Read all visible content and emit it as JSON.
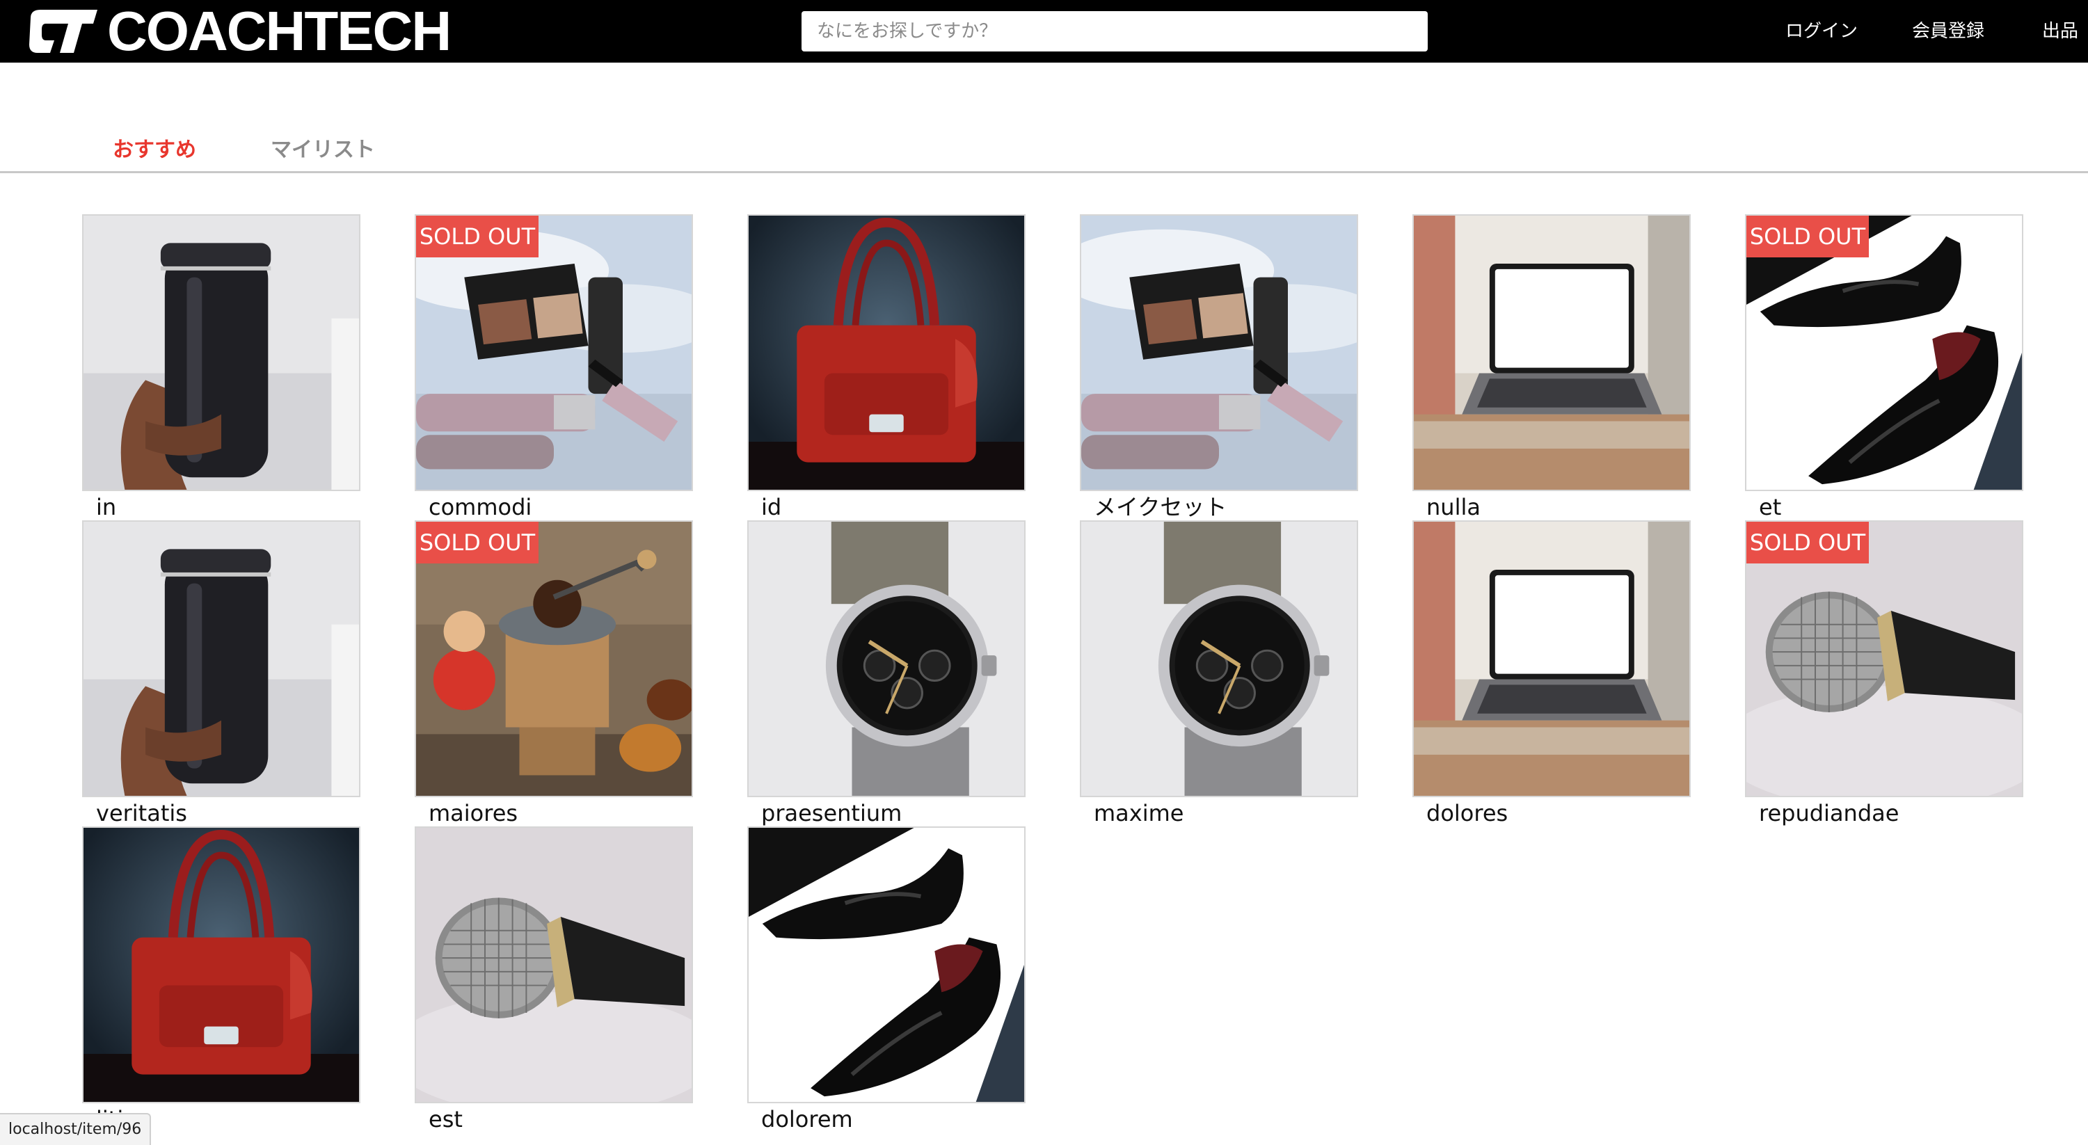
{
  "header": {
    "logo_text": "COACHTECH",
    "search_placeholder": "なにをお探しですか？",
    "nav": {
      "login": "ログイン",
      "register": "会員登録",
      "sell": "出品"
    }
  },
  "tabs": {
    "recommend": "おすすめ",
    "mylist": "マイリスト"
  },
  "sold_label": "SOLD OUT",
  "items": [
    {
      "name": "in",
      "image": "tumbler",
      "sold": false
    },
    {
      "name": "commodi",
      "image": "makeup-set",
      "sold": true
    },
    {
      "name": "id",
      "image": "red-handbag",
      "sold": false
    },
    {
      "name": "メイクセット",
      "image": "makeup-set",
      "sold": false
    },
    {
      "name": "nulla",
      "image": "laptop",
      "sold": false
    },
    {
      "name": "et",
      "image": "leather-shoes",
      "sold": true
    },
    {
      "name": "veritatis",
      "image": "tumbler",
      "sold": false
    },
    {
      "name": "maiores",
      "image": "coffee-grinder",
      "sold": true
    },
    {
      "name": "praesentium",
      "image": "wristwatch",
      "sold": false
    },
    {
      "name": "maxime",
      "image": "wristwatch",
      "sold": false
    },
    {
      "name": "dolores",
      "image": "laptop",
      "sold": false
    },
    {
      "name": "repudiandae",
      "image": "microphone",
      "sold": true
    },
    {
      "name": "litia",
      "image": "red-handbag",
      "sold": false
    },
    {
      "name": "est",
      "image": "microphone",
      "sold": false
    },
    {
      "name": "dolorem",
      "image": "leather-shoes",
      "sold": false
    }
  ],
  "statusbar": {
    "url": "localhost/item/96"
  },
  "colors": {
    "header_bg": "#000000",
    "accent_red": "#e8362d",
    "sold_badge": "#e94f48",
    "tab_inactive": "#8a8a8a"
  }
}
